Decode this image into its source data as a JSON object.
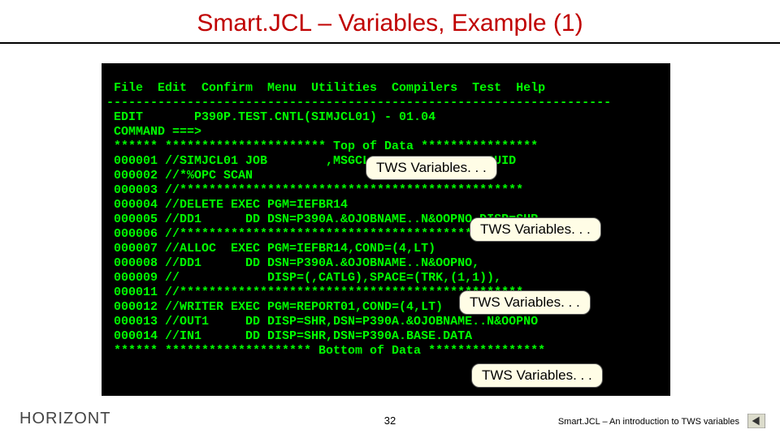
{
  "title": "Smart.JCL – Variables, Example (1)",
  "terminal": {
    "menu": " File  Edit  Confirm  Menu  Utilities  Compilers  Test  Help",
    "sep": "---------------------------------------------------------------------",
    "edit": " EDIT       P390P.TEST.CNTL(SIMJCL01) - 01.04",
    "cmd": " COMMAND ===>",
    "top": " ****** ********************** Top of Data ****************",
    "l1": " 000001 //SIMJCL01 JOB        ,MSGCLASS=X,NOTIFY=&SYSUID",
    "l2": " 000002 //*%OPC SCAN",
    "l3": " 000003 //***********************************************",
    "l4": " 000004 //DELETE EXEC PGM=IEFBR14",
    "l5": " 000005 //DD1      DD DSN=P390A.&OJOBNAME..N&OOPNO,DISP=SHR",
    "l6": " 000006 //***********************************************",
    "l7": " 000007 //ALLOC  EXEC PGM=IEFBR14,COND=(4,LT)",
    "l8": " 000008 //DD1      DD DSN=P390A.&OJOBNAME..N&OOPNO,",
    "l9": " 000009 //            DISP=(,CATLG),SPACE=(TRK,(1,1)),",
    "l11": " 000011 //***********************************************",
    "l12": " 000012 //WRITER EXEC PGM=REPORT01,COND=(4,LT)",
    "l13": " 000013 //OUT1     DD DISP=SHR,DSN=P390A.&OJOBNAME..N&OOPNO",
    "l14": " 000014 //IN1      DD DISP=SHR,DSN=P390A.BASE.DATA",
    "bot": " ****** ******************** Bottom of Data ****************"
  },
  "callouts": {
    "c1": "TWS Variables. . .",
    "c2": "TWS Variables. . .",
    "c3": "TWS Variables. . .",
    "c4": "TWS Variables. . ."
  },
  "footer": {
    "left": "HORIZONT",
    "center": "32",
    "right": "Smart.JCL – An introduction to TWS variables"
  }
}
